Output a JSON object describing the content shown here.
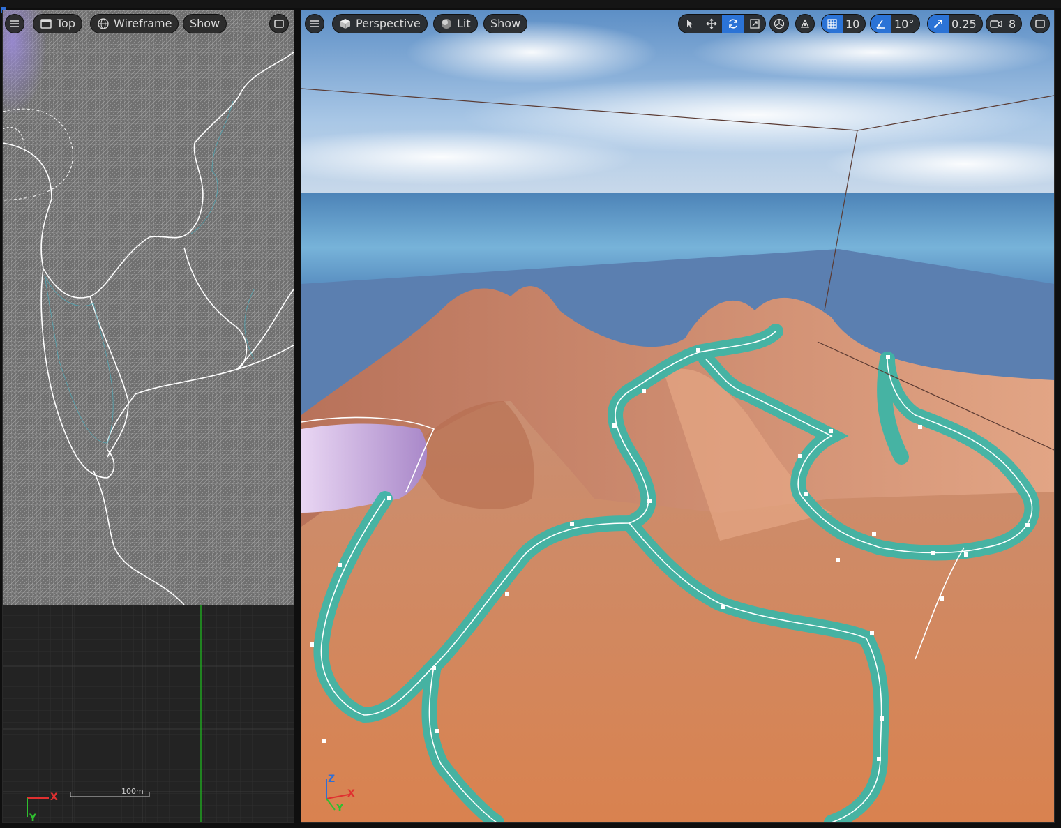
{
  "left_viewport": {
    "view_mode": "Top",
    "render_mode": "Wireframe",
    "show_label": "Show",
    "scale_label": "100m",
    "axis": {
      "x": "X",
      "y": "Y"
    }
  },
  "right_viewport": {
    "view_mode": "Perspective",
    "lighting": "Lit",
    "show_label": "Show",
    "grid_snap_value": "10",
    "rotation_snap_value": "10°",
    "scale_snap_value": "0.25",
    "camera_speed_value": "8",
    "axis": {
      "x": "X",
      "y": "Y",
      "z": "Z"
    }
  },
  "colors": {
    "accent": "#2b73d6",
    "sand": "#d98a5c",
    "water": "#3fb5a6",
    "sky": "#7fb0dc"
  },
  "icons": [
    "menu-icon",
    "top-view-icon",
    "wireframe-icon",
    "maximize-icon",
    "cube-icon",
    "lit-sphere-icon",
    "select-icon",
    "translate-icon",
    "rotate-icon",
    "scale-icon",
    "local-space-icon",
    "surface-snap-icon",
    "grid-icon",
    "angle-icon",
    "scale-snap-icon",
    "camera-icon"
  ]
}
